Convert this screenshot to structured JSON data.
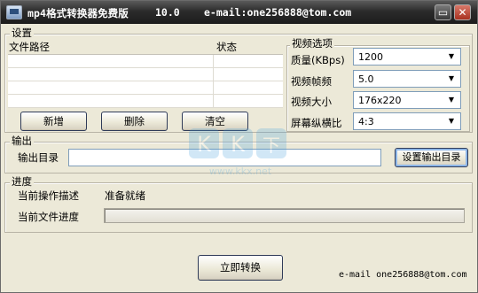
{
  "window": {
    "title": "mp4格式转换器免费版",
    "version": "10.0",
    "email": "e-mail:one256888@tom.com",
    "minimize_glyph": "▭",
    "close_glyph": "✕"
  },
  "settings": {
    "group_label": "设置",
    "col_path": "文件路径",
    "col_status": "状态",
    "buttons": {
      "add": "新增",
      "delete": "删除",
      "clear": "清空"
    }
  },
  "video_options": {
    "group_label": "视频选项",
    "quality": {
      "label": "质量(KBps)",
      "value": "1200"
    },
    "framerate": {
      "label": "视频帧频",
      "value": "5.0"
    },
    "size": {
      "label": "视频大小",
      "value": "176x220"
    },
    "aspect": {
      "label": "屏幕纵横比",
      "value": "4:3"
    }
  },
  "output": {
    "group_label": "输出",
    "dir_label": "输出目录",
    "dir_value": "",
    "set_dir_button": "设置输出目录"
  },
  "progress": {
    "group_label": "进度",
    "desc_label": "当前操作描述",
    "desc_value": "准备就绪",
    "file_progress_label": "当前文件进度",
    "file_progress_value": 0
  },
  "convert_button": "立即转换",
  "footer_email": "e-mail one256888@tom.com",
  "watermark": {
    "brand": "KK下载",
    "url": "www.kkx.net"
  },
  "colors": {
    "titlebar": "#2b2b2b",
    "window_bg": "#ece9d8",
    "accent": "#7f9db9"
  }
}
